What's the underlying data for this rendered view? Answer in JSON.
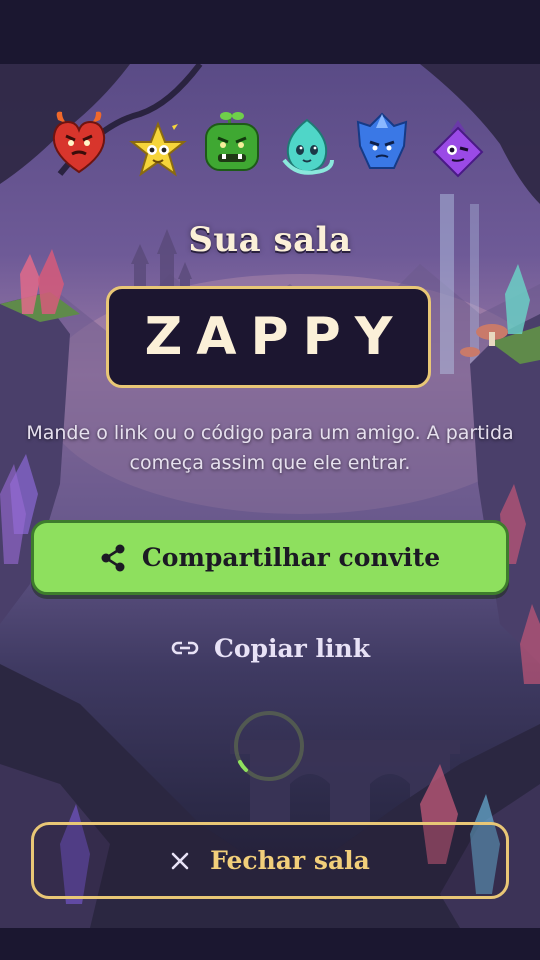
{
  "room": {
    "title": "Sua sala",
    "code": "ZAPPY",
    "instructions": "Mande o link ou o código para um amigo. A partida começa assim que ele entrar."
  },
  "actions": {
    "share_label": "Compartilhar convite",
    "share_icon": "share-icon",
    "copy_label": "Copiar link",
    "copy_icon": "link-icon",
    "close_label": "Fechar sala",
    "close_icon": "close-icon"
  },
  "monsters": [
    "red-devil-heart",
    "yellow-star",
    "green-ogre-sprout",
    "cyan-water-spirit",
    "blue-crystal",
    "purple-wizard-gem"
  ],
  "colors": {
    "background": "#1b1730",
    "accent_gold": "#e9c776",
    "share_green": "#8ee05e",
    "code_box": "#1c1630"
  }
}
